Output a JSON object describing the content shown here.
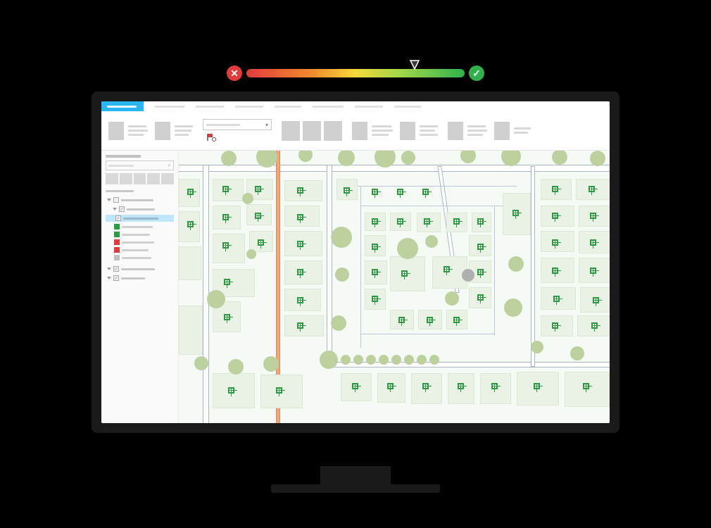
{
  "rating": {
    "value_percent": 77,
    "bad_icon": "x-icon",
    "good_icon": "check-icon"
  },
  "tabs": {
    "active_label": "",
    "inactive_count": 7
  },
  "ribbon": {
    "dropdown": {
      "selected": "",
      "arrow": "▾"
    },
    "tool_icon": "flag-tool-icon"
  },
  "panel": {
    "title": "",
    "search": {
      "placeholder": "",
      "icon": "search-icon"
    },
    "thumbnails": [
      "",
      "",
      "",
      "",
      ""
    ],
    "section": "",
    "layers": [
      {
        "checked": false,
        "label": ""
      },
      {
        "checked": true,
        "label": ""
      },
      {
        "checked": true,
        "label": "",
        "selected": true
      }
    ],
    "legend": [
      {
        "color": "#2a9d3f",
        "label": ""
      },
      {
        "color": "#2a9d3f",
        "label": ""
      },
      {
        "color": "#e23b3b",
        "label": ""
      },
      {
        "color": "#e23b3b",
        "label": ""
      },
      {
        "color": "#c0c0c0",
        "label": ""
      }
    ],
    "bottom_checks": [
      {
        "checked": true,
        "label": ""
      },
      {
        "checked": true,
        "label": ""
      }
    ]
  },
  "map": {
    "background": "neighborhood-basemap",
    "main_road_color": "#f2a57a",
    "marker_style": "green-square",
    "feature_point": {
      "type": "gray-dot"
    }
  }
}
